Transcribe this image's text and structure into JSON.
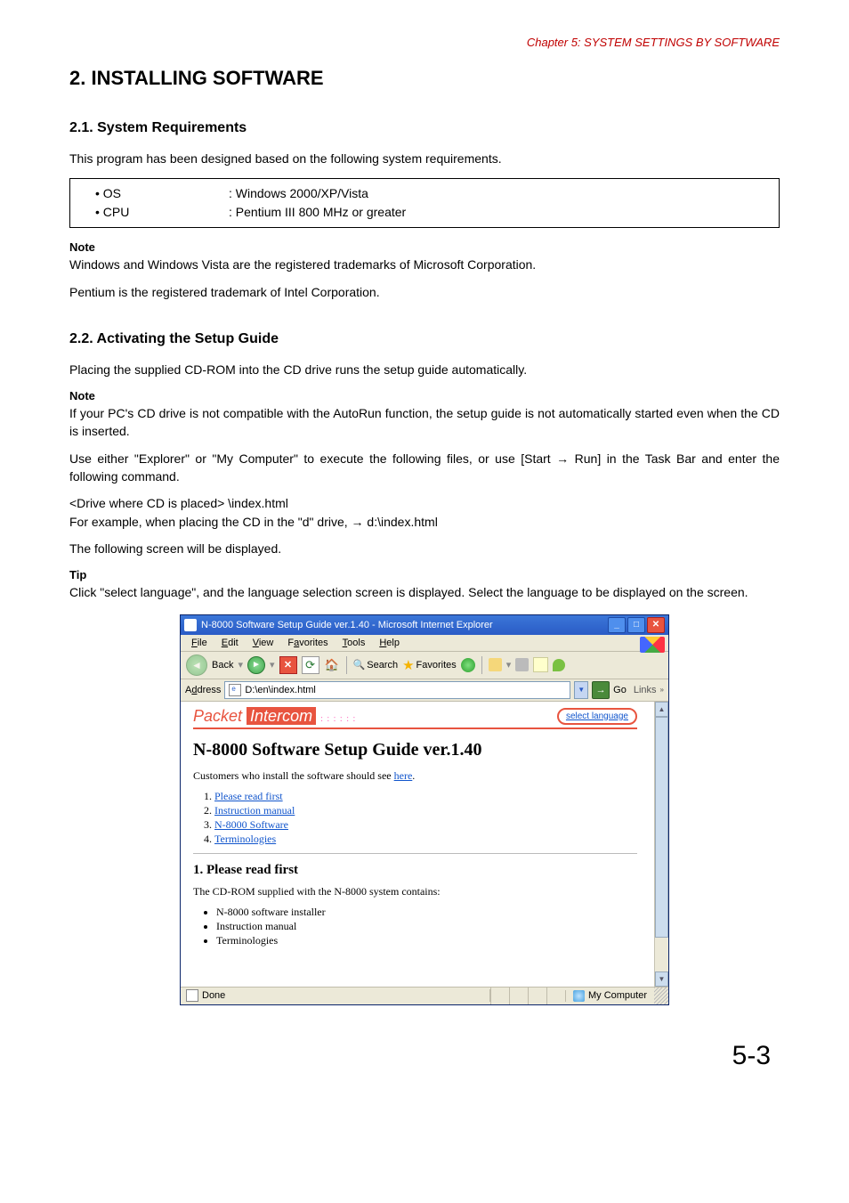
{
  "chapterHeader": "Chapter 5:  SYSTEM SETTINGS BY SOFTWARE",
  "h1": "2. INSTALLING SOFTWARE",
  "sec21": {
    "title": "2.1. System Requirements",
    "intro": "This program has been designed based on the following system requirements.",
    "rows": [
      {
        "k": "• OS",
        "v": ": Windows 2000/XP/Vista"
      },
      {
        "k": "• CPU",
        "v": ": Pentium III 800 MHz or greater"
      }
    ],
    "noteLabel": "Note",
    "note1": "Windows and Windows Vista are the registered trademarks of Microsoft Corporation.",
    "note2": "Pentium is the registered trademark of Intel Corporation."
  },
  "sec22": {
    "title": "2.2. Activating the Setup Guide",
    "p1": "Placing the supplied CD-ROM into the CD drive runs the setup guide automatically.",
    "noteLabel": "Note",
    "p2": "If your PC's CD drive is not compatible with the AutoRun function, the setup guide is not automatically started even when the CD is inserted.",
    "p3": "Use either \"Explorer\" or \"My Computer\" to execute the following files, or use [Start → Run] in the Task Bar and enter the following command.",
    "p4": "<Drive where CD is placed> \\index.html",
    "p5": "For example, when placing the CD in the \"d\" drive,  →  d:\\index.html",
    "p6": "The following screen will be displayed.",
    "tipLabel": "Tip",
    "p7": "Click \"select language\", and the language selection screen is displayed. Select the language to be displayed on the screen."
  },
  "ie": {
    "title": "N-8000 Software Setup Guide ver.1.40 - Microsoft Internet Explorer",
    "menus": {
      "file": "File",
      "edit": "Edit",
      "view": "View",
      "favorites": "Favorites",
      "tools": "Tools",
      "help": "Help"
    },
    "tb": {
      "back": "Back",
      "search": "Search",
      "favorites": "Favorites"
    },
    "addressLabel": "Address",
    "addressValue": "D:\\en\\index.html",
    "go": "Go",
    "links": "Links",
    "logoA": "Packet",
    "logoB": "Intercom",
    "selectLanguage": "select language",
    "guideTitle": "N-8000 Software Setup Guide ver.1.40",
    "guideLine": "Customers who install the software should see ",
    "guideHere": "here",
    "items": [
      "Please read first",
      "Instruction manual",
      "N-8000 Software",
      "Terminologies"
    ],
    "sec1Title": "1. Please read first",
    "sec1Line": "The CD-ROM supplied with the N-8000 system contains:",
    "sec1Items": [
      "N-8000 software installer",
      "Instruction manual",
      "Terminologies"
    ],
    "statusDone": "Done",
    "statusZone": "My Computer"
  },
  "pageNum": "5-3"
}
